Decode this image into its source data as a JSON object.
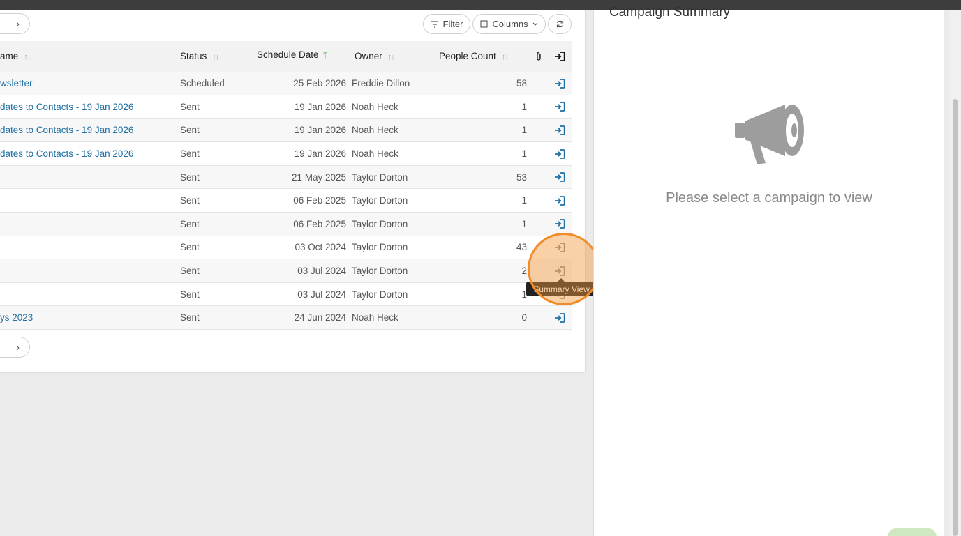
{
  "toolbar": {
    "filter_label": "Filter",
    "columns_label": "Columns",
    "pager_next": "›"
  },
  "table": {
    "headers": {
      "name": "ame",
      "status": "Status",
      "schedule_date": "Schedule Date",
      "owner": "Owner",
      "people_count": "People Count"
    },
    "rows": [
      {
        "name": "wsletter",
        "status": "Scheduled",
        "date": "25 Feb 2026",
        "owner": "Freddie Dillon",
        "count": "58"
      },
      {
        "name": "dates to Contacts - 19 Jan 2026",
        "status": "Sent",
        "date": "19 Jan 2026",
        "owner": "Noah Heck",
        "count": "1"
      },
      {
        "name": "dates to Contacts - 19 Jan 2026",
        "status": "Sent",
        "date": "19 Jan 2026",
        "owner": "Noah Heck",
        "count": "1"
      },
      {
        "name": "dates to Contacts - 19 Jan 2026",
        "status": "Sent",
        "date": "19 Jan 2026",
        "owner": "Noah Heck",
        "count": "1"
      },
      {
        "name": "",
        "status": "Sent",
        "date": "21 May 2025",
        "owner": "Taylor Dorton",
        "count": "53"
      },
      {
        "name": "",
        "status": "Sent",
        "date": "06 Feb 2025",
        "owner": "Taylor Dorton",
        "count": "1"
      },
      {
        "name": "",
        "status": "Sent",
        "date": "06 Feb 2025",
        "owner": "Taylor Dorton",
        "count": "1"
      },
      {
        "name": "",
        "status": "Sent",
        "date": "03 Oct 2024",
        "owner": "Taylor Dorton",
        "count": "43"
      },
      {
        "name": "",
        "status": "Sent",
        "date": "03 Jul 2024",
        "owner": "Taylor Dorton",
        "count": "2"
      },
      {
        "name": "",
        "status": "Sent",
        "date": "03 Jul 2024",
        "owner": "Taylor Dorton",
        "count": "1"
      },
      {
        "name": "ys 2023",
        "status": "Sent",
        "date": "24 Jun 2024",
        "owner": "Noah Heck",
        "count": "0"
      }
    ]
  },
  "tooltip": {
    "text": "Summary View"
  },
  "summary": {
    "title": "Campaign Summary",
    "empty_message": "Please select a campaign to view"
  },
  "colors": {
    "link": "#1f6fa3",
    "highlight": "#f28c28",
    "sort_active": "#3cb043"
  },
  "icons": [
    "filter-icon",
    "columns-icon",
    "chevron-down-icon",
    "refresh-icon",
    "sort-icon",
    "sort-ascending-icon",
    "attachment-icon",
    "login-icon",
    "megaphone-icon"
  ]
}
